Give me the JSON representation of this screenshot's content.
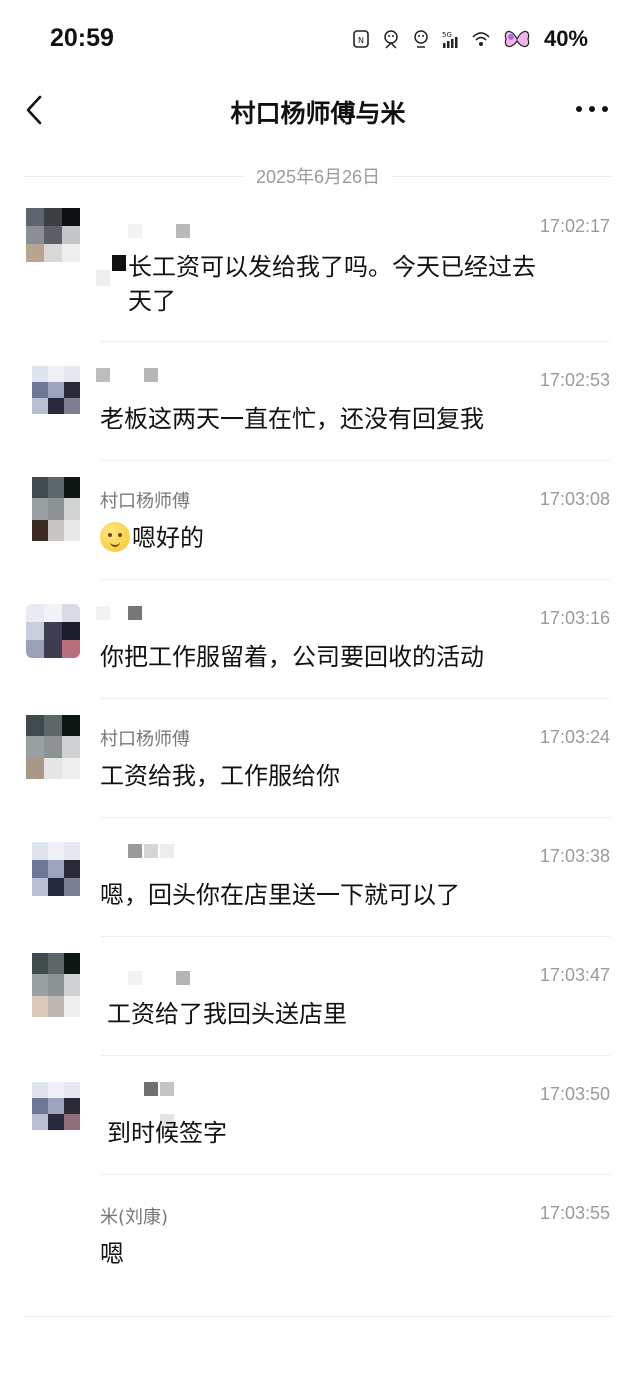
{
  "status_bar": {
    "time": "20:59",
    "battery": "40%",
    "icons": [
      "nfc-icon",
      "sticker-icon",
      "sticker-icon",
      "signal-5g-icon",
      "wifi-icon",
      "butterfly-icon"
    ]
  },
  "nav": {
    "title": "村口杨师傅与米",
    "back_icon": "chevron-left-icon",
    "more_icon": "more-dots-icon"
  },
  "date_divider": "2025年6月26日",
  "messages": [
    {
      "sender": "",
      "time": "17:02:17",
      "text": "长工资可以发给我了吗。今天已经过去",
      "text2": "天了"
    },
    {
      "sender": "",
      "time": "17:02:53",
      "text": "老板这两天一直在忙，还没有回复我"
    },
    {
      "sender": "村口杨师傅",
      "time": "17:03:08",
      "text": "嗯好的"
    },
    {
      "sender": "",
      "time": "17:03:16",
      "text": "你把工作服留着，公司要回收的活动"
    },
    {
      "sender": "村口杨师傅",
      "time": "17:03:24",
      "text": "工资给我，工作服给你"
    },
    {
      "sender": "",
      "time": "17:03:38",
      "text": "嗯，回头你在店里送一下就可以了"
    },
    {
      "sender": "",
      "time": "17:03:47",
      "text": "工资给了我回头送店里"
    },
    {
      "sender": "",
      "time": "17:03:50",
      "text": "到时候签字"
    },
    {
      "sender": "米(刘康)",
      "time": "17:03:55",
      "text": "嗯"
    }
  ],
  "colors": {
    "text": "#111111",
    "secondary": "#777777",
    "time": "#9a9a9a",
    "divider": "#efefef"
  }
}
